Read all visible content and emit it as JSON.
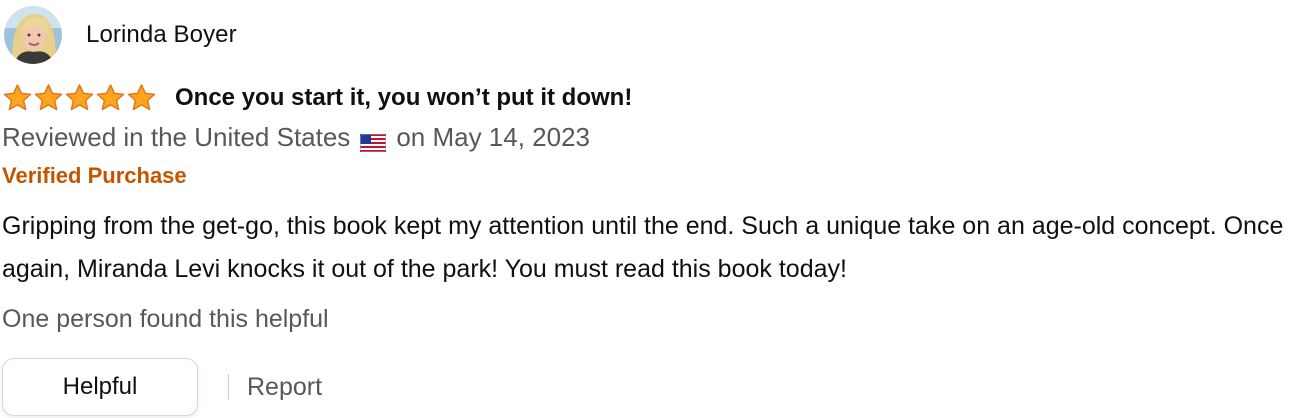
{
  "reviewer": {
    "name": "Lorinda Boyer",
    "avatar_icon": "profile-photo"
  },
  "rating": {
    "stars": 5,
    "max_stars": 5,
    "star_color": "#ffa41c",
    "star_border_color": "#de7921"
  },
  "review": {
    "title": "Once you start it, you won’t put it down!",
    "location_prefix": "Reviewed in the United States",
    "flag_icon": "us-flag-icon",
    "date_text": "on May 14, 2023",
    "verified_label": "Verified Purchase",
    "verified_color": "#c45500",
    "body": "Gripping from the get-go, this book kept my attention until the end. Such a unique take on an age-old concept. Once again, Miranda Levi knocks it out of the park! You must read this book today!",
    "helpful_count_text": "One person found this helpful"
  },
  "actions": {
    "helpful_label": "Helpful",
    "report_label": "Report"
  }
}
